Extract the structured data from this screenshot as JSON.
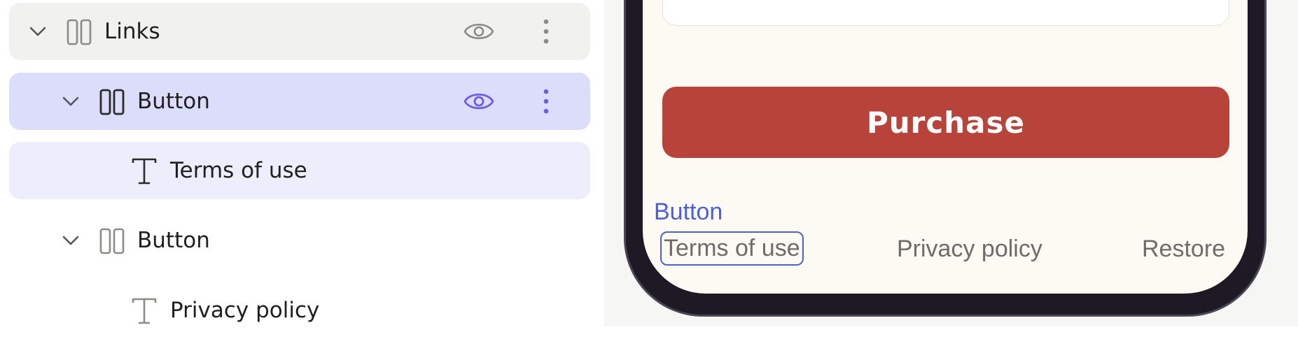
{
  "tree": {
    "rows": [
      {
        "label": "Links",
        "icon": "columns-icon",
        "expanded": true,
        "visible": true
      },
      {
        "label": "Button",
        "icon": "columns-icon",
        "expanded": true,
        "visible": true,
        "selected": true
      },
      {
        "label": "Terms of use",
        "icon": "text-icon"
      },
      {
        "label": "Button",
        "icon": "columns-icon",
        "expanded": true
      },
      {
        "label": "Privacy policy",
        "icon": "text-icon"
      }
    ]
  },
  "preview": {
    "purchase_label": "Purchase",
    "selection_tag": "Button",
    "links": [
      "Terms of use",
      "Privacy policy",
      "Restore"
    ],
    "colors": {
      "accent": "#4c5fd9",
      "purchase_bg": "#b8433a",
      "screen_bg": "#fdfaf3",
      "selected_row": "#dcdcfb"
    }
  }
}
